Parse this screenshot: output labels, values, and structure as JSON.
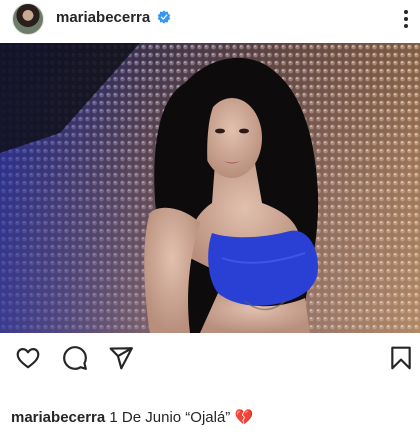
{
  "header": {
    "username": "mariabecerra",
    "verified": true,
    "avatar_icon": "profile-avatar",
    "more_icon": "more-vertical-icon"
  },
  "post": {
    "image_alt": "photo"
  },
  "actions": {
    "like_icon": "heart-icon",
    "comment_icon": "comment-icon",
    "share_icon": "send-icon",
    "save_icon": "bookmark-icon"
  },
  "caption": {
    "username": "mariabecerra",
    "text": "1 De Junio “Ojalá”",
    "emoji": "💔"
  },
  "colors": {
    "text": "#262626",
    "verified": "#3897f0",
    "accent_blue": "#2a3fd4"
  }
}
